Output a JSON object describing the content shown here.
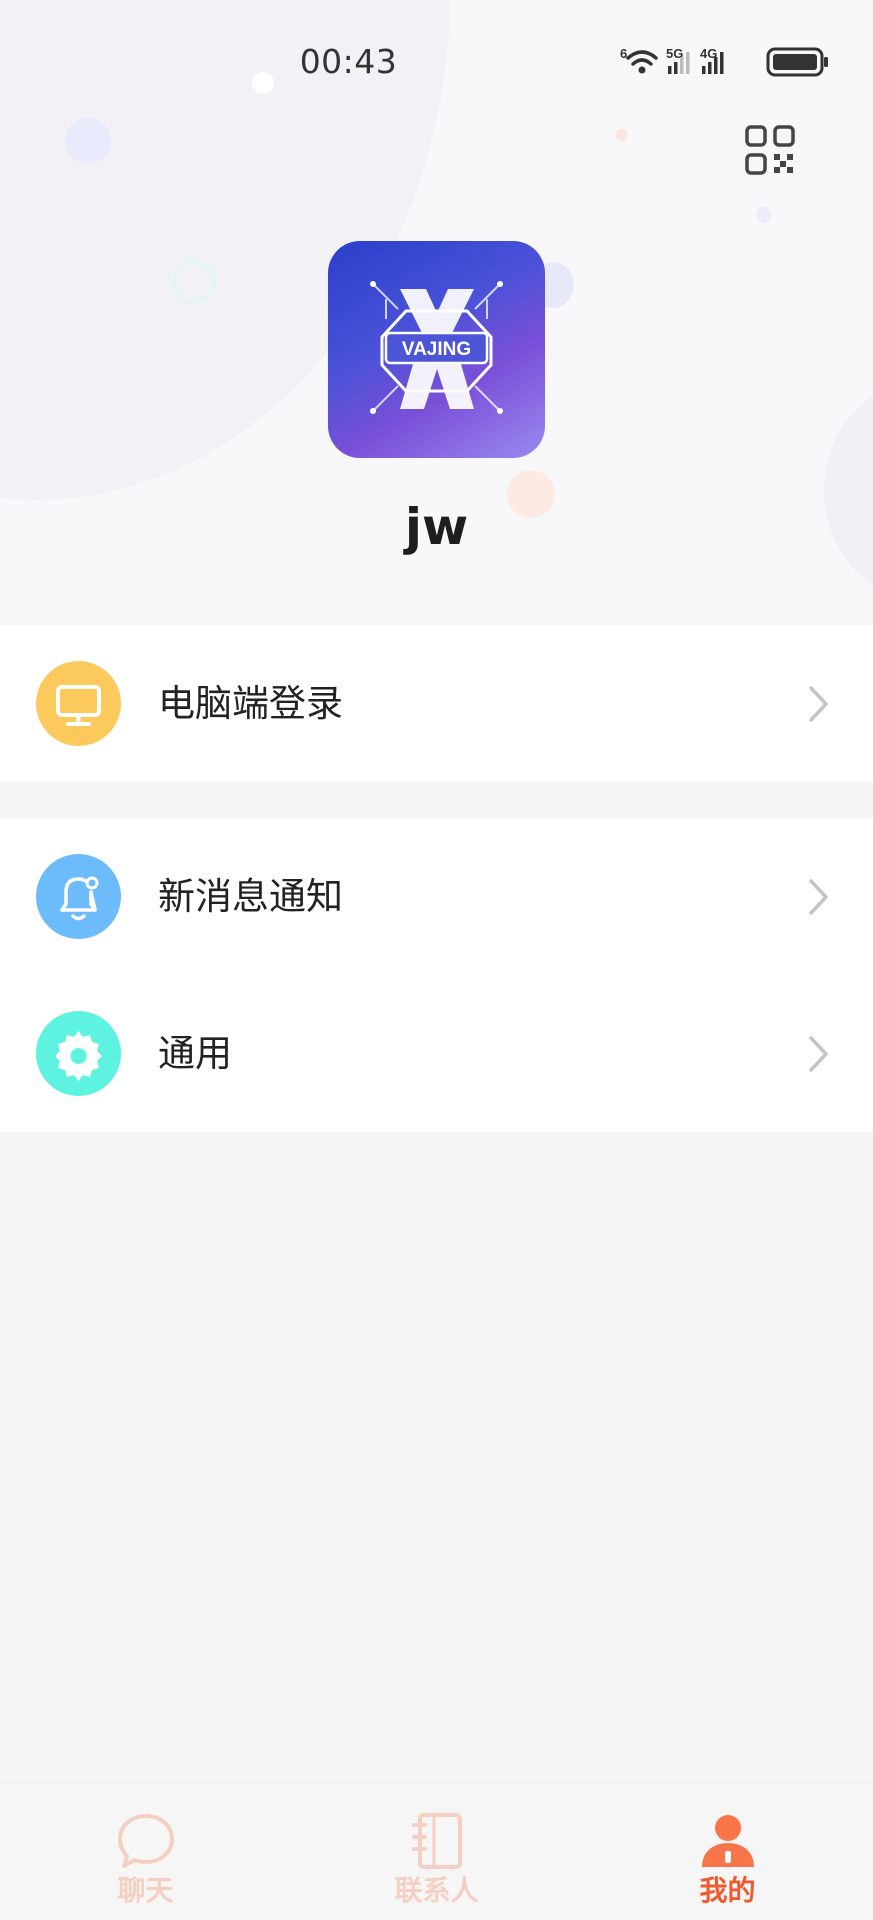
{
  "status_bar": {
    "time": "00:43",
    "network_1": "5G",
    "network_2": "4G"
  },
  "profile": {
    "avatar_text": "VAJING",
    "username": "jw"
  },
  "menu": {
    "groups": [
      {
        "items": [
          {
            "label": "电脑端登录",
            "icon": "monitor-icon",
            "color": "#fcc95c"
          }
        ]
      },
      {
        "items": [
          {
            "label": "新消息通知",
            "icon": "bell-icon",
            "color": "#6cbcfb"
          },
          {
            "label": "通用",
            "icon": "gear-icon",
            "color": "#5ef2e0"
          }
        ]
      }
    ]
  },
  "tabbar": {
    "tabs": [
      {
        "label": "聊天",
        "icon": "chat-icon",
        "active": false
      },
      {
        "label": "联系人",
        "icon": "contacts-icon",
        "active": false
      },
      {
        "label": "我的",
        "icon": "profile-icon",
        "active": true
      }
    ],
    "active_color": "#f05a2e",
    "inactive_color": "#f6cfc3"
  }
}
